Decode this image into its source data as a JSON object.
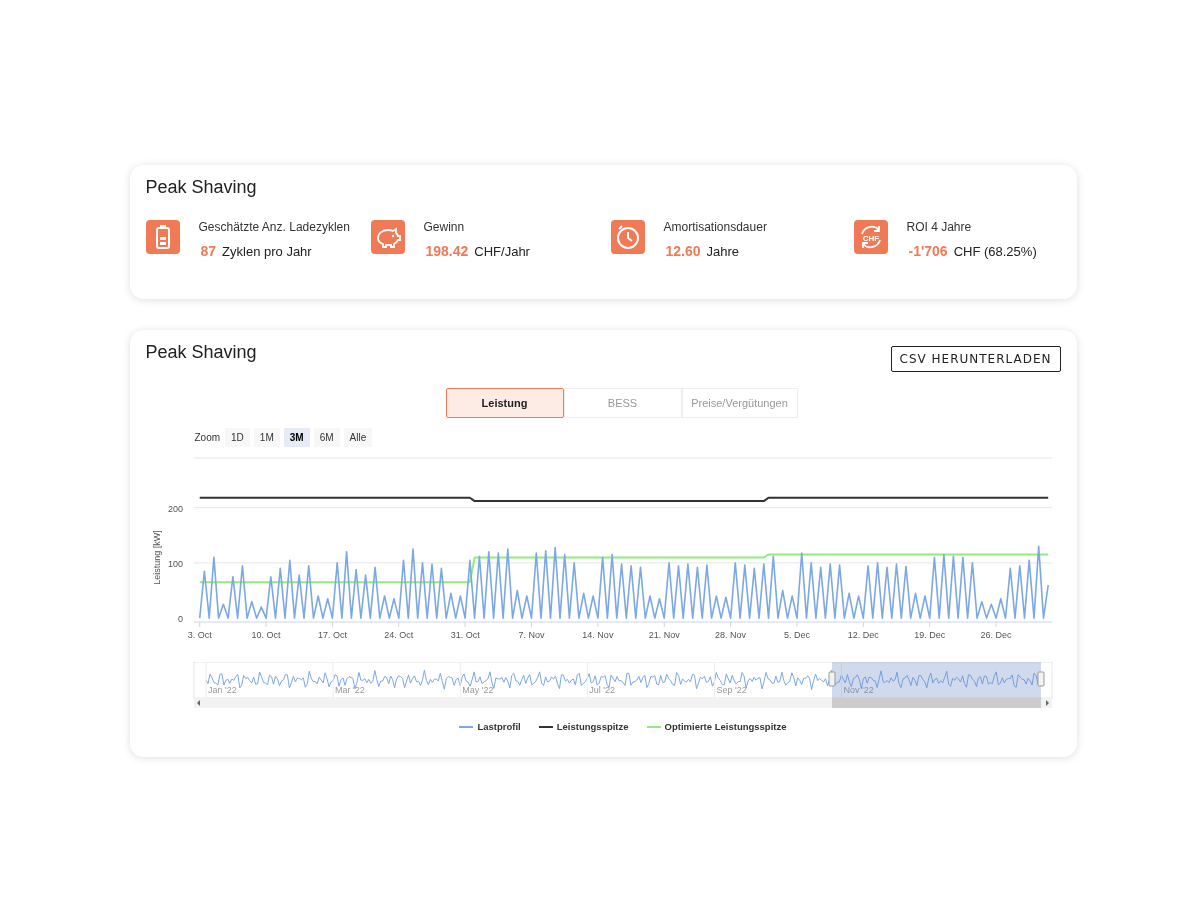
{
  "summary": {
    "title": "Peak Shaving",
    "kpis": [
      {
        "label": "Geschätzte Anz. Ladezyklen",
        "value": "87",
        "unit": "Zyklen pro Jahr"
      },
      {
        "label": "Gewinn",
        "value": "198.42",
        "unit": "CHF/Jahr"
      },
      {
        "label": "Amortisationsdauer",
        "value": "12.60",
        "unit": "Jahre"
      },
      {
        "label": "ROI 4 Jahre",
        "value": "-1'706",
        "unit": "CHF (68.25%)",
        "icon_text": "CHF"
      }
    ]
  },
  "detail": {
    "title": "Peak Shaving",
    "download_button": "CSV HERUNTERLADEN",
    "tabs": [
      {
        "label": "Leistung",
        "selected": true
      },
      {
        "label": "BESS",
        "selected": false
      },
      {
        "label": "Preise/Vergütungen",
        "selected": false
      }
    ],
    "zoom": {
      "label": "Zoom",
      "buttons": [
        {
          "label": "1D",
          "selected": false
        },
        {
          "label": "1M",
          "selected": false
        },
        {
          "label": "3M",
          "selected": true
        },
        {
          "label": "6M",
          "selected": false
        },
        {
          "label": "Alle",
          "selected": false
        }
      ]
    },
    "chart_data": {
      "type": "line",
      "ylabel": "Leistung [kW]",
      "ylim": [
        -7,
        290
      ],
      "yticks": [
        0,
        100,
        200
      ],
      "categories": [
        "3. Oct",
        null,
        null,
        null,
        null,
        null,
        null,
        null,
        null,
        null,
        null,
        null,
        null,
        null,
        "10. Oct",
        null,
        null,
        null,
        null,
        null,
        null,
        null,
        null,
        null,
        null,
        null,
        null,
        null,
        "17. Oct",
        null,
        null,
        null,
        null,
        null,
        null,
        null,
        null,
        null,
        null,
        null,
        null,
        null,
        "24. Oct",
        null,
        null,
        null,
        null,
        null,
        null,
        null,
        null,
        null,
        null,
        null,
        null,
        null,
        "31. Oct",
        null,
        null,
        null,
        null,
        null,
        null,
        null,
        null,
        null,
        null,
        null,
        null,
        null,
        "7. Nov",
        null,
        null,
        null,
        null,
        null,
        null,
        null,
        null,
        null,
        null,
        null,
        null,
        null,
        "14. Nov",
        null,
        null,
        null,
        null,
        null,
        null,
        null,
        null,
        null,
        null,
        null,
        null,
        null,
        "21. Nov",
        null,
        null,
        null,
        null,
        null,
        null,
        null,
        null,
        null,
        null,
        null,
        null,
        null,
        "28. Nov",
        null,
        null,
        null,
        null,
        null,
        null,
        null,
        null,
        null,
        null,
        null,
        null,
        null,
        "5. Dec",
        null,
        null,
        null,
        null,
        null,
        null,
        null,
        null,
        null,
        null,
        null,
        null,
        null,
        "12. Dec",
        null,
        null,
        null,
        null,
        null,
        null,
        null,
        null,
        null,
        null,
        null,
        null,
        null,
        "19. Dec",
        null,
        null,
        null,
        null,
        null,
        null,
        null,
        null,
        null,
        null,
        null,
        null,
        null,
        "26. Dec",
        null,
        null,
        null,
        null,
        null,
        null,
        null,
        null,
        null,
        null,
        null
      ],
      "series": [
        {
          "name": "Lastprofil",
          "color": "#7ca8e6",
          "values": [
            0,
            85,
            0,
            110,
            0,
            25,
            0,
            75,
            0,
            95,
            0,
            30,
            0,
            20,
            0,
            75,
            0,
            90,
            0,
            105,
            0,
            78,
            0,
            95,
            0,
            40,
            0,
            35,
            0,
            100,
            0,
            120,
            0,
            88,
            0,
            78,
            0,
            92,
            0,
            40,
            0,
            35,
            0,
            105,
            0,
            125,
            0,
            100,
            0,
            98,
            0,
            90,
            0,
            45,
            0,
            40,
            0,
            105,
            0,
            112,
            0,
            120,
            0,
            118,
            0,
            125,
            0,
            50,
            0,
            40,
            0,
            118,
            0,
            122,
            0,
            128,
            0,
            115,
            0,
            100,
            0,
            45,
            0,
            40,
            0,
            110,
            0,
            115,
            0,
            98,
            0,
            95,
            0,
            92,
            0,
            40,
            0,
            35,
            0,
            100,
            0,
            95,
            0,
            98,
            0,
            92,
            0,
            96,
            0,
            40,
            0,
            38,
            0,
            100,
            0,
            96,
            0,
            90,
            0,
            98,
            0,
            112,
            0,
            50,
            0,
            40,
            0,
            118,
            0,
            100,
            0,
            92,
            0,
            98,
            0,
            96,
            0,
            45,
            0,
            40,
            0,
            95,
            0,
            100,
            0,
            92,
            0,
            98,
            0,
            94,
            0,
            45,
            0,
            40,
            0,
            110,
            0,
            115,
            0,
            112,
            0,
            110,
            0,
            100,
            0,
            30,
            0,
            25,
            0,
            35,
            0,
            90,
            0,
            95,
            0,
            105,
            0,
            130,
            0,
            60
          ]
        },
        {
          "name": "Leistungsspitze",
          "color": "#333333",
          "values": [
            218,
            218,
            218,
            218,
            218,
            218,
            218,
            218,
            218,
            218,
            218,
            218,
            218,
            218,
            218,
            218,
            218,
            218,
            218,
            218,
            218,
            218,
            218,
            218,
            218,
            218,
            218,
            218,
            218,
            218,
            218,
            218,
            218,
            218,
            218,
            218,
            218,
            218,
            218,
            218,
            218,
            218,
            218,
            218,
            218,
            218,
            218,
            218,
            218,
            218,
            218,
            218,
            218,
            218,
            218,
            218,
            218,
            218,
            212,
            212,
            212,
            212,
            212,
            212,
            212,
            212,
            212,
            212,
            212,
            212,
            212,
            212,
            212,
            212,
            212,
            212,
            212,
            212,
            212,
            212,
            212,
            212,
            212,
            212,
            212,
            212,
            212,
            212,
            212,
            212,
            212,
            212,
            212,
            212,
            212,
            212,
            212,
            212,
            212,
            212,
            212,
            212,
            212,
            212,
            212,
            212,
            212,
            212,
            212,
            212,
            212,
            212,
            212,
            212,
            212,
            212,
            212,
            212,
            212,
            212,
            218,
            218,
            218,
            218,
            218,
            218,
            218,
            218,
            218,
            218,
            218,
            218,
            218,
            218,
            218,
            218,
            218,
            218,
            218,
            218,
            218,
            218,
            218,
            218,
            218,
            218,
            218,
            218,
            218,
            218,
            218,
            218,
            218,
            218,
            218,
            218,
            218,
            218,
            218,
            218,
            218,
            218,
            218,
            218,
            218,
            218,
            218,
            218,
            218,
            218,
            218,
            218,
            218,
            218,
            218,
            218,
            218,
            218,
            218,
            218
          ]
        },
        {
          "name": "Optimierte Leistungsspitze",
          "color": "#90ed7d",
          "values": [
            65,
            65,
            65,
            65,
            65,
            65,
            65,
            65,
            65,
            65,
            65,
            65,
            65,
            65,
            65,
            65,
            65,
            65,
            65,
            65,
            65,
            65,
            65,
            65,
            65,
            65,
            65,
            65,
            65,
            65,
            65,
            65,
            65,
            65,
            65,
            65,
            65,
            65,
            65,
            65,
            65,
            65,
            65,
            65,
            65,
            65,
            65,
            65,
            65,
            65,
            65,
            65,
            65,
            65,
            65,
            65,
            65,
            65,
            110,
            110,
            110,
            110,
            110,
            110,
            110,
            110,
            110,
            110,
            110,
            110,
            110,
            110,
            110,
            110,
            110,
            110,
            110,
            110,
            110,
            110,
            110,
            110,
            110,
            110,
            110,
            110,
            110,
            110,
            110,
            110,
            110,
            110,
            110,
            110,
            110,
            110,
            110,
            110,
            110,
            110,
            110,
            110,
            110,
            110,
            110,
            110,
            110,
            110,
            110,
            110,
            110,
            110,
            110,
            110,
            110,
            110,
            110,
            110,
            110,
            110,
            115,
            115,
            115,
            115,
            115,
            115,
            115,
            115,
            115,
            115,
            115,
            115,
            115,
            115,
            115,
            115,
            115,
            115,
            115,
            115,
            115,
            115,
            115,
            115,
            115,
            115,
            115,
            115,
            115,
            115,
            115,
            115,
            115,
            115,
            115,
            115,
            115,
            115,
            115,
            115,
            115,
            115,
            115,
            115,
            115,
            115,
            115,
            115,
            115,
            115,
            115,
            115,
            115,
            115,
            115,
            115,
            115,
            115,
            115,
            115
          ]
        }
      ]
    },
    "navigator": {
      "labels": [
        "Jan '22",
        "Mar '22",
        "May '22",
        "Jul '22",
        "Sep '22",
        "Nov '22"
      ]
    }
  }
}
